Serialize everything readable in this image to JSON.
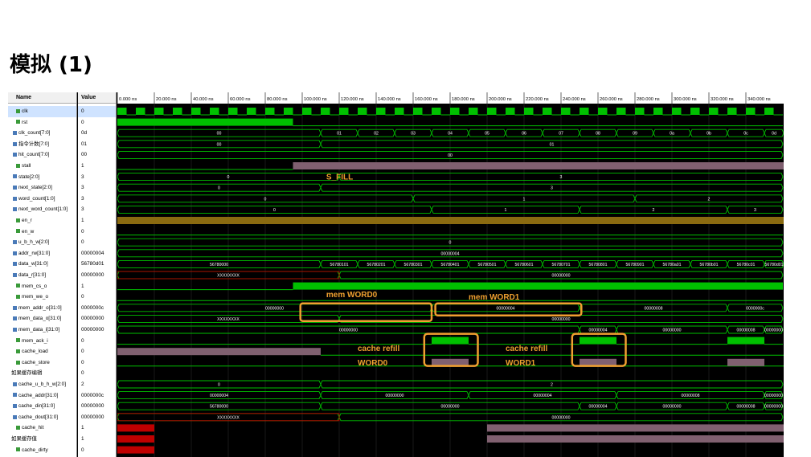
{
  "slide_title": "模拟 (1)",
  "columns": {
    "name": "Name",
    "value": "Value"
  },
  "time_ticks": [
    "0.000 ns",
    "20.000 ns",
    "40.000 ns",
    "60.000 ns",
    "80.000 ns",
    "100.000 ns",
    "120.000 ns",
    "140.000 ns",
    "160.000 ns",
    "180.000 ns",
    "200.000 ns",
    "220.000 ns",
    "240.000 ns",
    "260.000 ns",
    "280.000 ns",
    "300.000 ns",
    "320.000 ns",
    "340.000 ns"
  ],
  "signals": [
    {
      "name": "clk",
      "value": "0",
      "kind": "bit"
    },
    {
      "name": "rst",
      "value": "0",
      "kind": "bit"
    },
    {
      "name": "clk_count[7:0]",
      "value": "0d",
      "kind": "bus"
    },
    {
      "name": "指令计数[7:0]",
      "value": "01",
      "kind": "bus"
    },
    {
      "name": "hit_count[7:0]",
      "value": "00",
      "kind": "bus"
    },
    {
      "name": "stall",
      "value": "1",
      "kind": "bit"
    },
    {
      "name": "state[2:0]",
      "value": "3",
      "kind": "bus"
    },
    {
      "name": "next_state[2:0]",
      "value": "3",
      "kind": "bus"
    },
    {
      "name": "word_count[1:0]",
      "value": "3",
      "kind": "bus"
    },
    {
      "name": "next_word_count[1:0]",
      "value": "3",
      "kind": "bus"
    },
    {
      "name": "en_r",
      "value": "1",
      "kind": "bit"
    },
    {
      "name": "en_w",
      "value": "0",
      "kind": "bit"
    },
    {
      "name": "u_b_h_w[2:0]",
      "value": "0",
      "kind": "bus"
    },
    {
      "name": "addr_rw[31:0]",
      "value": "00000004",
      "kind": "bus"
    },
    {
      "name": "data_w[31:0]",
      "value": "56780d01",
      "kind": "bus"
    },
    {
      "name": "data_r[31:0]",
      "value": "00000000",
      "kind": "bus"
    },
    {
      "name": "mem_cs_o",
      "value": "1",
      "kind": "bit"
    },
    {
      "name": "mem_we_o",
      "value": "0",
      "kind": "bit"
    },
    {
      "name": "mem_addr_o[31:0]",
      "value": "0000000c",
      "kind": "bus"
    },
    {
      "name": "mem_data_o[31:0]",
      "value": "00000000",
      "kind": "bus"
    },
    {
      "name": "mem_data_i[31:0]",
      "value": "00000000",
      "kind": "bus"
    },
    {
      "name": "mem_ack_i",
      "value": "0",
      "kind": "bit"
    },
    {
      "name": "cache_load",
      "value": "0",
      "kind": "bit"
    },
    {
      "name": "cache_store",
      "value": "0",
      "kind": "bit"
    },
    {
      "name": "如果缓存编辑",
      "value": "0",
      "kind": "label"
    },
    {
      "name": "cache_u_b_h_w[2:0]",
      "value": "2",
      "kind": "bus"
    },
    {
      "name": "cache_addr[31:0]",
      "value": "0000000c",
      "kind": "bus"
    },
    {
      "name": "cache_din[31:0]",
      "value": "00000000",
      "kind": "bus"
    },
    {
      "name": "cache_dout[31:0]",
      "value": "00000000",
      "kind": "bus"
    },
    {
      "name": "cache_hit",
      "value": "1",
      "kind": "bit"
    },
    {
      "name": "如果缓存值",
      "value": "1",
      "kind": "label"
    },
    {
      "name": "cache_dirty",
      "value": "0",
      "kind": "bit"
    }
  ],
  "bus_labels": {
    "clk_count": [
      "00",
      "01",
      "02",
      "03",
      "04",
      "05",
      "06",
      "07",
      "08",
      "09",
      "0a",
      "0b",
      "0c",
      "0d"
    ],
    "instr_count": [
      "00",
      "01"
    ],
    "hit_count": "00",
    "state": [
      "0",
      "3"
    ],
    "next_state": [
      "0",
      "3"
    ],
    "word_count": [
      "0",
      "1",
      "2",
      "3"
    ],
    "next_word_count": [
      "0",
      "1",
      "2",
      "3"
    ],
    "u_b_h_w": "0",
    "addr_rw": "00000004",
    "data_w": [
      "56780000",
      "56780101",
      "56780201",
      "56780301",
      "56780401",
      "56780501",
      "56780601",
      "56780701",
      "56780801",
      "56780901",
      "56780a01",
      "56780b01",
      "56780c01",
      "56780d01"
    ],
    "data_r": [
      "XXXXXXXX",
      "00000000"
    ],
    "mem_addr_o": [
      "00000000",
      "00000004",
      "00000008",
      "0000000c"
    ],
    "mem_data_o": [
      "XXXXXXXX",
      "00000000"
    ],
    "mem_data_i": [
      "00000000",
      "00000004",
      "00000000",
      "00000008",
      "00000000"
    ],
    "cache_u_b_h_w": [
      "0",
      "2"
    ],
    "cache_addr": [
      "00000004",
      "00000000",
      "00000004",
      "00000008",
      "00000000"
    ],
    "cache_din": [
      "56780000",
      "00000000",
      "00000004",
      "00000000",
      "00000008",
      "00000000"
    ],
    "cache_dout": [
      "XXXXXXXX",
      "00000000"
    ]
  },
  "annotations": {
    "s_fill": "S_FILL",
    "mem_word0": "mem WORD0",
    "mem_word1": "mem WORD1",
    "refill0_line1": "cache refill",
    "refill0_line2": "WORD0",
    "refill1_line1": "cache refill",
    "refill1_line2": "WORD1"
  },
  "colors": {
    "wave_bg": "#000000",
    "bit_high": "#00c000",
    "bus_line": "#00c000",
    "highlight": "#f0a030",
    "undefined": "#c00000",
    "stall_fill": "#806070"
  }
}
